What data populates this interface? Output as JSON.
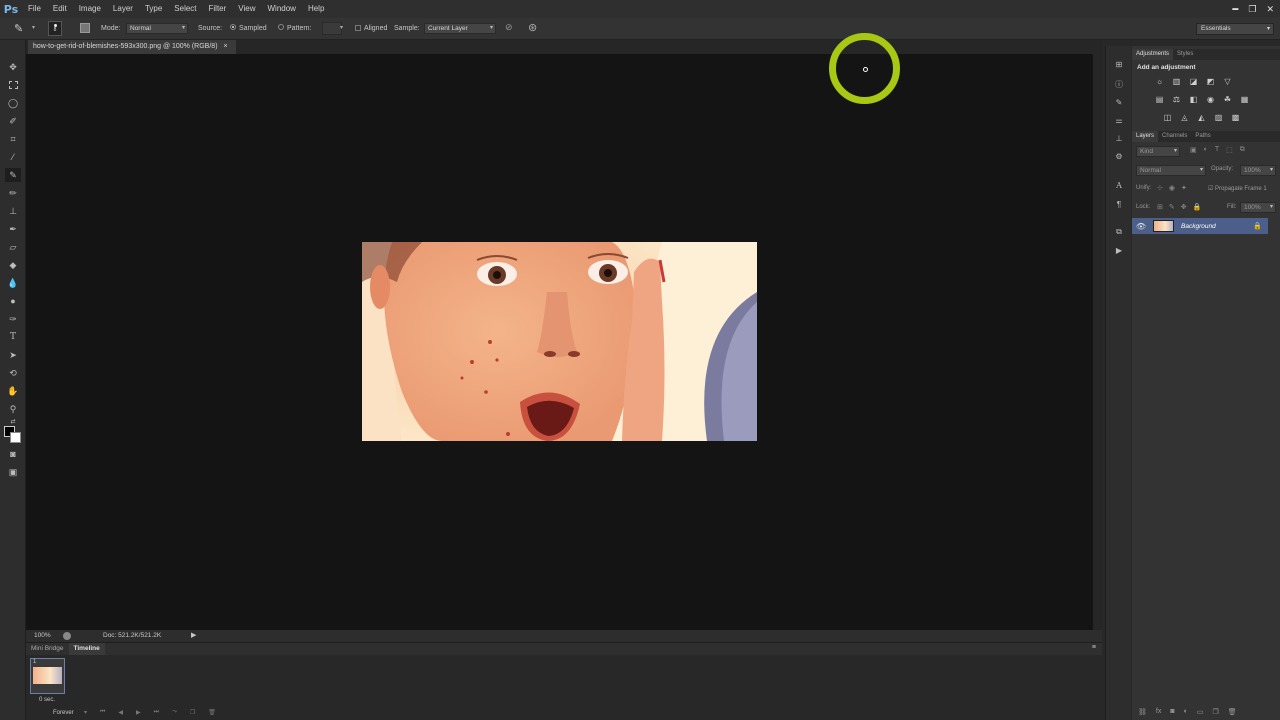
{
  "app": {
    "logo": "Ps"
  },
  "menu": [
    "File",
    "Edit",
    "Image",
    "Layer",
    "Type",
    "Select",
    "Filter",
    "View",
    "Window",
    "Help"
  ],
  "window_controls": {
    "minimize": "▬",
    "restore": "❐",
    "close": "✕"
  },
  "options_bar": {
    "mode_label": "Mode:",
    "mode_value": "Normal",
    "source_label": "Source:",
    "sampled_label": "Sampled",
    "pattern_label": "Pattern:",
    "aligned_label": "Aligned",
    "sample_label": "Sample:",
    "sample_value": "Current Layer",
    "brush_size": "8"
  },
  "workspace": {
    "value": "Essentials"
  },
  "document": {
    "tab_title": "how-to-get-rid-of-blemishes-593x300.png @ 100% (RGB/8)",
    "tab_close": "×"
  },
  "status_bar": {
    "zoom": "100%",
    "doc_size": "Doc: 521.2K/521.2K"
  },
  "timeline": {
    "tabs": [
      "Mini Bridge",
      "Timeline"
    ],
    "frame_number": "1",
    "frame_delay": "0 sec.",
    "loop": "Forever"
  },
  "adjustments_panel": {
    "tabs": [
      "Adjustments",
      "Styles"
    ],
    "heading": "Add an adjustment"
  },
  "layers_panel": {
    "tabs": [
      "Layers",
      "Channels",
      "Paths"
    ],
    "kind_filter": "Kind",
    "blend_mode": "Normal",
    "opacity_label": "Opacity:",
    "opacity_value": "100%",
    "unify_label": "Unify:",
    "propagate_label": "Propagate Frame 1",
    "lock_label": "Lock:",
    "fill_label": "Fill:",
    "fill_value": "100%",
    "layers": [
      {
        "name": "Background",
        "locked": true,
        "visible": true,
        "selected": true
      }
    ]
  },
  "colors": {
    "accent_cursor": "#a8c813",
    "selected_layer": "#4b5f8a"
  }
}
